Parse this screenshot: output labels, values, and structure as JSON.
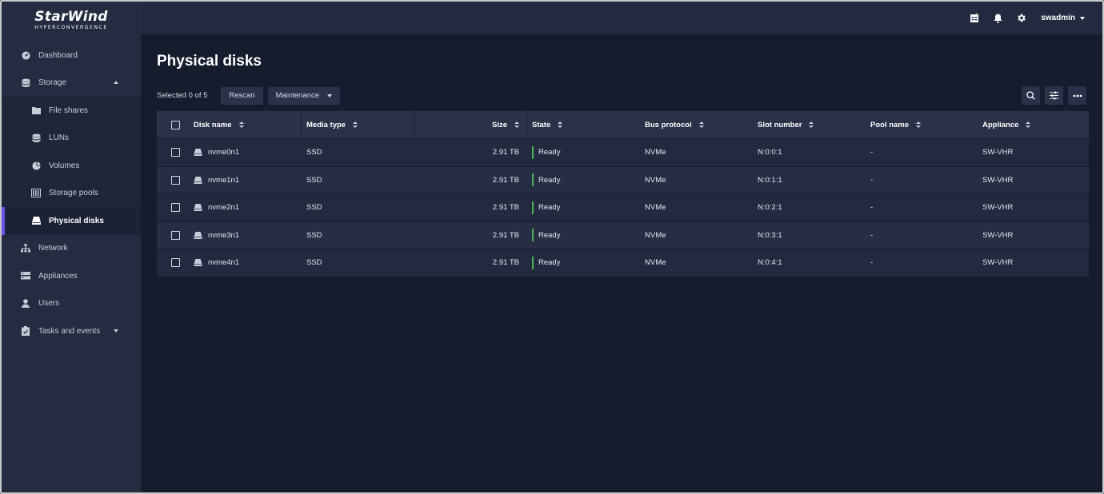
{
  "brand": {
    "name": "StarWind",
    "sub": "HYPERCONVERGENCE"
  },
  "sidebar": {
    "items": [
      {
        "label": "Dashboard",
        "icon": "dashboard-icon"
      },
      {
        "label": "Storage",
        "icon": "storage-icon"
      },
      {
        "label": "File shares",
        "icon": "file-shares-icon"
      },
      {
        "label": "LUNs",
        "icon": "luns-icon"
      },
      {
        "label": "Volumes",
        "icon": "volumes-icon"
      },
      {
        "label": "Storage pools",
        "icon": "storage-pools-icon"
      },
      {
        "label": "Physical disks",
        "icon": "physical-disk-icon"
      },
      {
        "label": "Network",
        "icon": "network-icon"
      },
      {
        "label": "Appliances",
        "icon": "appliances-icon"
      },
      {
        "label": "Users",
        "icon": "users-icon"
      },
      {
        "label": "Tasks and events",
        "icon": "tasks-icon"
      }
    ]
  },
  "header": {
    "user": "swadmin"
  },
  "page": {
    "title": "Physical disks",
    "selected": "Selected 0 of 5",
    "rescan": "Rescan",
    "maintenance": "Maintenance"
  },
  "table": {
    "columns": [
      "Disk name",
      "Media type",
      "Size",
      "State",
      "Bus protocol",
      "Slot number",
      "Pool name",
      "Appliance"
    ],
    "rows": [
      {
        "name": "nvme0n1",
        "media": "SSD",
        "size": "2.91 TB",
        "state": "Ready",
        "bus": "NVMe",
        "slot": "N:0:0:1",
        "pool": "-",
        "appliance": "SW-VHR"
      },
      {
        "name": "nvme1n1",
        "media": "SSD",
        "size": "2.91 TB",
        "state": "Ready",
        "bus": "NVMe",
        "slot": "N:0:1:1",
        "pool": "-",
        "appliance": "SW-VHR"
      },
      {
        "name": "nvme2n1",
        "media": "SSD",
        "size": "2.91 TB",
        "state": "Ready",
        "bus": "NVMe",
        "slot": "N:0:2:1",
        "pool": "-",
        "appliance": "SW-VHR"
      },
      {
        "name": "nvme3n1",
        "media": "SSD",
        "size": "2.91 TB",
        "state": "Ready",
        "bus": "NVMe",
        "slot": "N:0:3:1",
        "pool": "-",
        "appliance": "SW-VHR"
      },
      {
        "name": "nvme4n1",
        "media": "SSD",
        "size": "2.91 TB",
        "state": "Ready",
        "bus": "NVMe",
        "slot": "N:0:4:1",
        "pool": "-",
        "appliance": "SW-VHR"
      }
    ]
  },
  "colors": {
    "accent": "#6c52e6",
    "ready": "#4caf50",
    "sidebar_bg": "#252b40",
    "main_bg": "#161b2e"
  }
}
